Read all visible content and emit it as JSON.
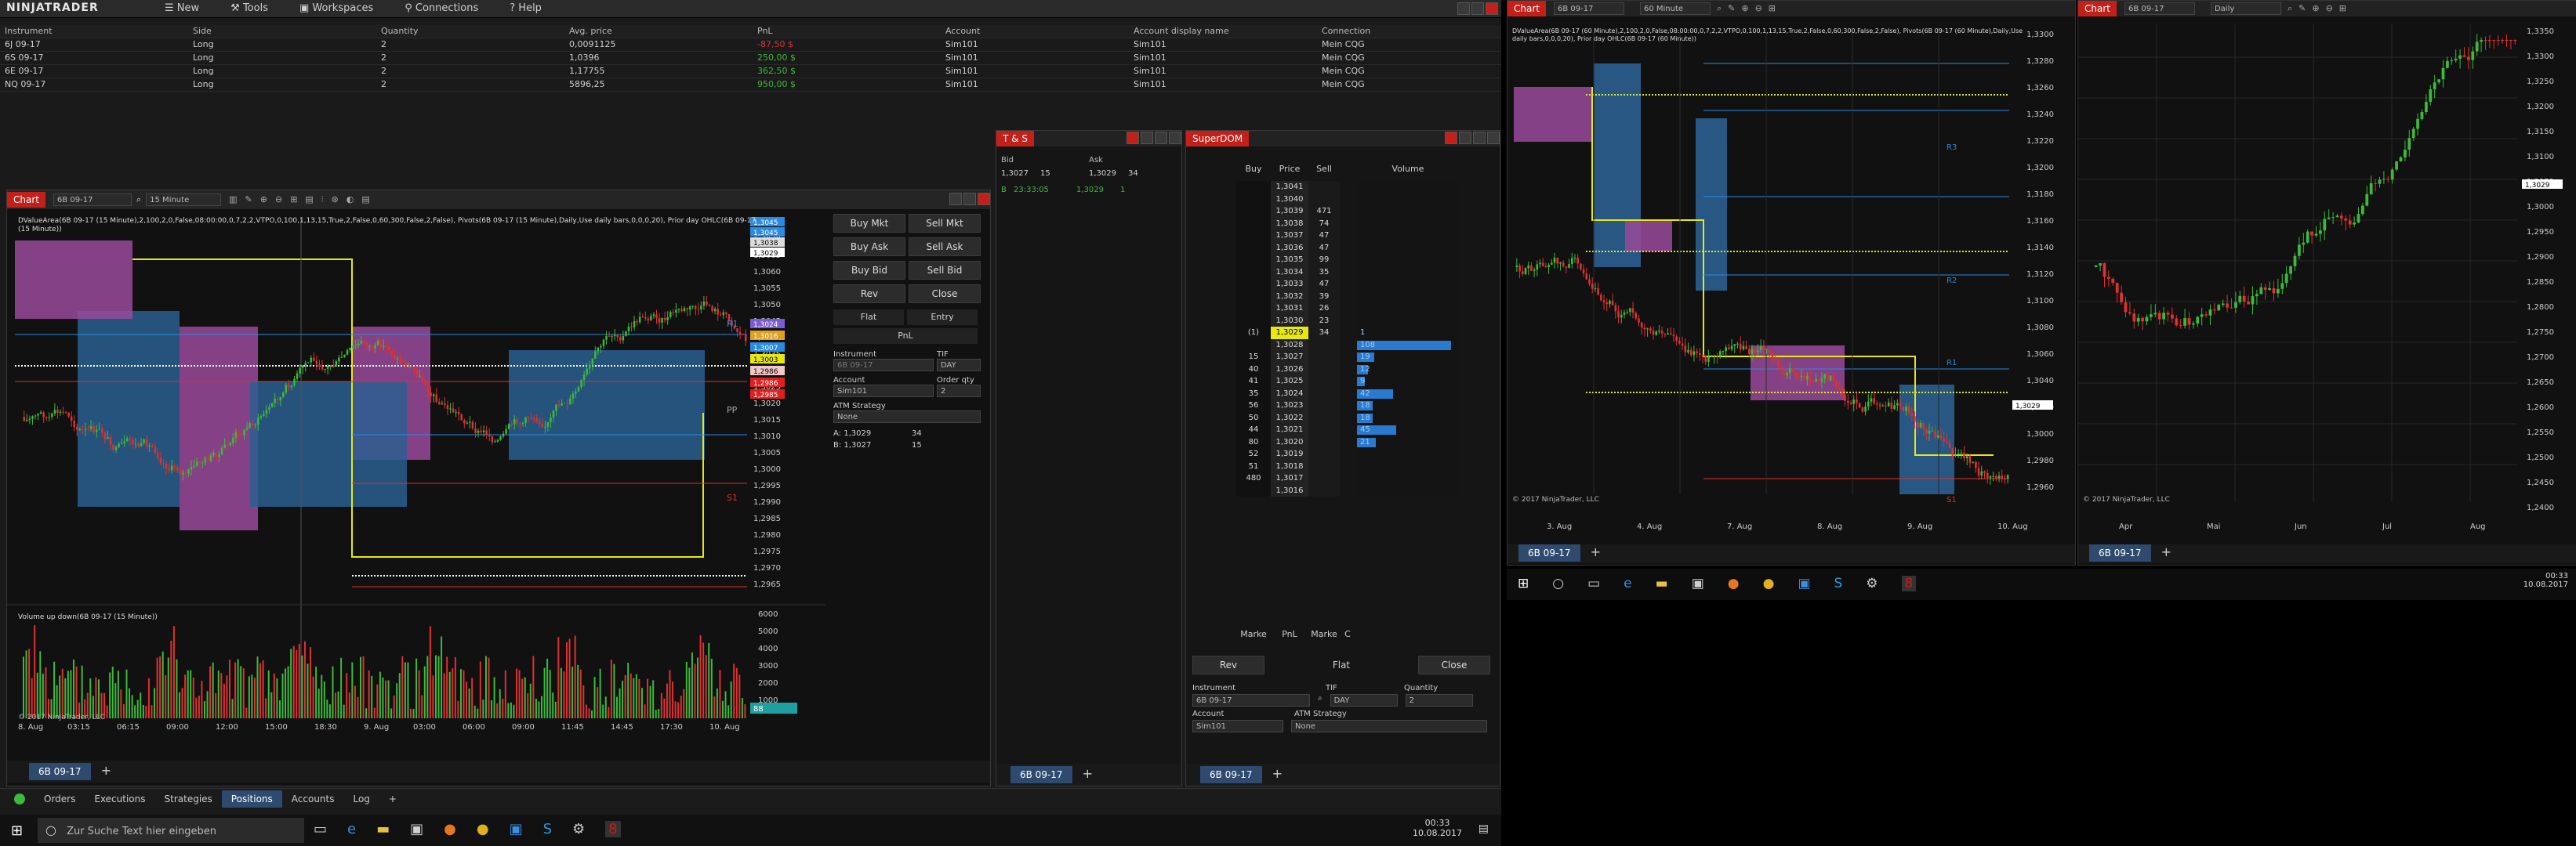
{
  "menu": {
    "logo": "NINJATRADER",
    "items": [
      "New",
      "Tools",
      "Workspaces",
      "Connections",
      "Help"
    ]
  },
  "positions": {
    "columns": [
      "Instrument",
      "Side",
      "Quantity",
      "Avg. price",
      "PnL",
      "Account",
      "Account display name",
      "Connection"
    ],
    "rows": [
      {
        "instrument": "6J 09-17",
        "side": "Long",
        "qty": "2",
        "avg": "0,0091125",
        "pnl": "-87,50 $",
        "account": "Sim101",
        "display": "Sim101",
        "conn": "Mein CQG",
        "neg": true
      },
      {
        "instrument": "6S 09-17",
        "side": "Long",
        "qty": "2",
        "avg": "1,0396",
        "pnl": "250,00 $",
        "account": "Sim101",
        "display": "Sim101",
        "conn": "Mein CQG",
        "neg": false
      },
      {
        "instrument": "6E 09-17",
        "side": "Long",
        "qty": "2",
        "avg": "1,17755",
        "pnl": "362,50 $",
        "account": "Sim101",
        "display": "Sim101",
        "conn": "Mein CQG",
        "neg": false
      },
      {
        "instrument": "NQ 09-17",
        "side": "Long",
        "qty": "2",
        "avg": "5896,25",
        "pnl": "950,00 $",
        "account": "Sim101",
        "display": "Sim101",
        "conn": "Mein CQG",
        "neg": false
      }
    ]
  },
  "chart1": {
    "tab": "Chart",
    "instrument": "6B 09-17",
    "interval": "15 Minute",
    "indicator_text": "DValueArea(6B 09-17 (15 Minute),2,100,2,0,False,08:00:00,0,7,2,2,VTPO,0,100,1,13,15,True,2,False,0,60,300,False,2,False), Pivots(6B 09-17 (15 Minute),Daily,Use daily bars,0,0,0,20), Prior day OHLC(6B 09-17 (15 Minute))",
    "price_labels": [
      "1,3075",
      "1,3070",
      "1,3065",
      "1,3060",
      "1,3055",
      "1,3050",
      "1,3045",
      "1,3040",
      "1,3035",
      "1,3030",
      "1,3025",
      "1,3020",
      "1,3015",
      "1,3010",
      "1,3005",
      "1,3000",
      "1,2995",
      "1,2990",
      "1,2985",
      "1,2980",
      "1,2975",
      "1,2970",
      "1,2965"
    ],
    "flags": [
      {
        "text": "1,3045",
        "color": "#2a8be0"
      },
      {
        "text": "1,3045",
        "color": "#2a8be0"
      },
      {
        "text": "1,3038",
        "color": "#dddddd"
      },
      {
        "text": "1,3029",
        "color": "#ffffff"
      },
      {
        "text": "1,3024",
        "color": "#7b5bd6"
      },
      {
        "text": "1,3016",
        "color": "#e0a020"
      },
      {
        "text": "1,3007",
        "color": "#2a8be0"
      },
      {
        "text": "1,3003",
        "color": "#e8e810"
      },
      {
        "text": "1,2986",
        "color": "#f0c8c8"
      },
      {
        "text": "1,2986",
        "color": "#e02020"
      },
      {
        "text": "1,2985",
        "color": "#e02020"
      }
    ],
    "volume_label": "Volume up down(6B 09-17 (15 Minute))",
    "volume_ticks": [
      "6000",
      "5000",
      "4000",
      "3000",
      "2000",
      "1000"
    ],
    "volume_value": "88",
    "copyright": "© 2017 NinjaTrader, LLC",
    "x_labels": [
      "8. Aug",
      "03:15",
      "06:15",
      "09:00",
      "12:00",
      "15:00",
      "18:30",
      "9. Aug",
      "03:00",
      "06:00",
      "09:00",
      "11:45",
      "14:45",
      "17:30",
      "10. Aug"
    ],
    "bottom_tab": "6B 09-17",
    "pivot_labels": [
      "R1",
      "PP",
      "S1"
    ]
  },
  "chart_trader": {
    "buy_mkt": "Buy Mkt",
    "sell_mkt": "Sell Mkt",
    "buy_ask": "Buy Ask",
    "sell_ask": "Sell Ask",
    "buy_bid": "Buy Bid",
    "sell_bid": "Sell Bid",
    "rev": "Rev",
    "close": "Close",
    "flat": "Flat",
    "entry": "Entry",
    "pnl": "PnL",
    "instrument_label": "Instrument",
    "instrument": "6B 09-17",
    "tif_label": "TIF",
    "tif": "DAY",
    "account_label": "Account",
    "account": "Sim101",
    "order_qty_label": "Order qty",
    "order_qty": "2",
    "atm_label": "ATM Strategy",
    "atm": "None",
    "ask_line": "A: 1,3029",
    "ask_qty": "34",
    "bid_line": "B: 1,3027",
    "bid_qty": "15"
  },
  "ts": {
    "title": "T & S",
    "bid_header": "Bid",
    "ask_header": "Ask",
    "bid": "1,3027",
    "bid_size": "15",
    "ask": "1,3029",
    "ask_size": "34",
    "row": {
      "mark": "B",
      "time": "23:33:05",
      "price": "1,3029",
      "size": "1"
    },
    "bottom_tab": "6B 09-17"
  },
  "superdom": {
    "title": "SuperDOM",
    "headers": [
      "Buy",
      "Price",
      "Sell",
      "Volume"
    ],
    "rows": [
      {
        "buy": "",
        "price": "1,3041",
        "sell": "",
        "vol": "",
        "vbar": 0
      },
      {
        "buy": "",
        "price": "1,3040",
        "sell": "",
        "vol": "",
        "vbar": 0
      },
      {
        "buy": "",
        "price": "1,3039",
        "sell": "471",
        "vol": "",
        "vbar": 0
      },
      {
        "buy": "",
        "price": "1,3038",
        "sell": "74",
        "vol": "",
        "vbar": 0
      },
      {
        "buy": "",
        "price": "1,3037",
        "sell": "47",
        "vol": "",
        "vbar": 0
      },
      {
        "buy": "",
        "price": "1,3036",
        "sell": "47",
        "vol": "",
        "vbar": 0
      },
      {
        "buy": "",
        "price": "1,3035",
        "sell": "99",
        "vol": "",
        "vbar": 0
      },
      {
        "buy": "",
        "price": "1,3034",
        "sell": "35",
        "vol": "",
        "vbar": 0
      },
      {
        "buy": "",
        "price": "1,3033",
        "sell": "47",
        "vol": "",
        "vbar": 0
      },
      {
        "buy": "",
        "price": "1,3032",
        "sell": "39",
        "vol": "",
        "vbar": 0
      },
      {
        "buy": "",
        "price": "1,3031",
        "sell": "26",
        "vol": "",
        "vbar": 0
      },
      {
        "buy": "",
        "price": "1,3030",
        "sell": "23",
        "vol": "",
        "vbar": 0
      },
      {
        "buy": "(1)",
        "price": "1,3029",
        "sell": "34",
        "vol": "1",
        "vbar": 0
      },
      {
        "buy": "",
        "price": "1,3028",
        "sell": "",
        "vol": "108",
        "vbar": 1.0
      },
      {
        "buy": "15",
        "price": "1,3027",
        "sell": "",
        "vol": "19",
        "vbar": 0.18
      },
      {
        "buy": "40",
        "price": "1,3026",
        "sell": "",
        "vol": "12",
        "vbar": 0.12
      },
      {
        "buy": "41",
        "price": "1,3025",
        "sell": "",
        "vol": "9",
        "vbar": 0.08
      },
      {
        "buy": "35",
        "price": "1,3024",
        "sell": "",
        "vol": "42",
        "vbar": 0.38
      },
      {
        "buy": "56",
        "price": "1,3023",
        "sell": "",
        "vol": "18",
        "vbar": 0.17
      },
      {
        "buy": "50",
        "price": "1,3022",
        "sell": "",
        "vol": "18",
        "vbar": 0.17
      },
      {
        "buy": "44",
        "price": "1,3021",
        "sell": "",
        "vol": "45",
        "vbar": 0.42
      },
      {
        "buy": "80",
        "price": "1,3020",
        "sell": "",
        "vol": "21",
        "vbar": 0.2
      },
      {
        "buy": "52",
        "price": "1,3019",
        "sell": "",
        "vol": "",
        "vbar": 0
      },
      {
        "buy": "51",
        "price": "1,3018",
        "sell": "",
        "vol": "",
        "vbar": 0
      },
      {
        "buy": "480",
        "price": "1,3017",
        "sell": "",
        "vol": "",
        "vbar": 0
      },
      {
        "buy": "",
        "price": "1,3016",
        "sell": "",
        "vol": "",
        "vbar": 0
      }
    ],
    "footer": [
      "Marke",
      "PnL",
      "Marke",
      "C"
    ],
    "rev": "Rev",
    "flat": "Flat",
    "close": "Close",
    "instrument_label": "Instrument",
    "instrument": "6B 09-17",
    "tif_label": "TIF",
    "tif": "DAY",
    "qty_label": "Quantity",
    "qty": "2",
    "account_label": "Account",
    "account": "Sim101",
    "atm_label": "ATM Strategy",
    "atm": "None",
    "bottom_tab": "6B 09-17"
  },
  "chart2": {
    "tab": "Chart",
    "instrument": "6B 09-17",
    "interval": "60 Minute",
    "indicator_text": "DValueArea(6B 09-17 (60 Minute),2,100,2,0,False,08:00:00,0,7,2,2,VTPO,0,100,1,13,15,True,2,False,0,60,300,False,2,False), Pivots(6B 09-17 (60 Minute),Daily,Use daily bars,0,0,0,20), Prior day OHLC(6B 09-17 (60 Minute))",
    "price_labels": [
      "1,3300",
      "1,3280",
      "1,3260",
      "1,3240",
      "1,3220",
      "1,3200",
      "1,3180",
      "1,3160",
      "1,3140",
      "1,3120",
      "1,3100",
      "1,3080",
      "1,3060",
      "1,3040",
      "1,3020",
      "1,3000",
      "1,2980",
      "1,2960"
    ],
    "last_price": "1,3029",
    "x_labels": [
      "3. Aug",
      "4. Aug",
      "7. Aug",
      "8. Aug",
      "9. Aug",
      "10. Aug"
    ],
    "copyright": "© 2017 NinjaTrader, LLC",
    "bottom_tab": "6B 09-17",
    "pivot_labels": [
      "R3",
      "R2",
      "R1",
      "S1"
    ]
  },
  "chart3": {
    "tab": "Chart",
    "instrument": "6B 09-17",
    "interval": "Daily",
    "price_labels": [
      "1,3350",
      "1,3300",
      "1,3250",
      "1,3200",
      "1,3150",
      "1,3100",
      "1,3050",
      "1,3000",
      "1,2950",
      "1,2900",
      "1,2850",
      "1,2800",
      "1,2750",
      "1,2700",
      "1,2650",
      "1,2600",
      "1,2550",
      "1,2500",
      "1,2450",
      "1,2400"
    ],
    "last_price": "1,3029",
    "x_labels": [
      "Apr",
      "Mai",
      "Jun",
      "Jul",
      "Aug"
    ],
    "copyright": "© 2017 NinjaTrader, LLC",
    "bottom_tab": "6B 09-17"
  },
  "control_center_tabs": [
    "Orders",
    "Executions",
    "Strategies",
    "Positions",
    "Accounts",
    "Log"
  ],
  "active_tab": "Positions",
  "taskbar_left": {
    "search": "Zur Suche Text hier eingeben",
    "time": "00:33",
    "date": "10.08.2017"
  },
  "taskbar_right": {
    "time": "00:33",
    "date": "10.08.2017"
  }
}
